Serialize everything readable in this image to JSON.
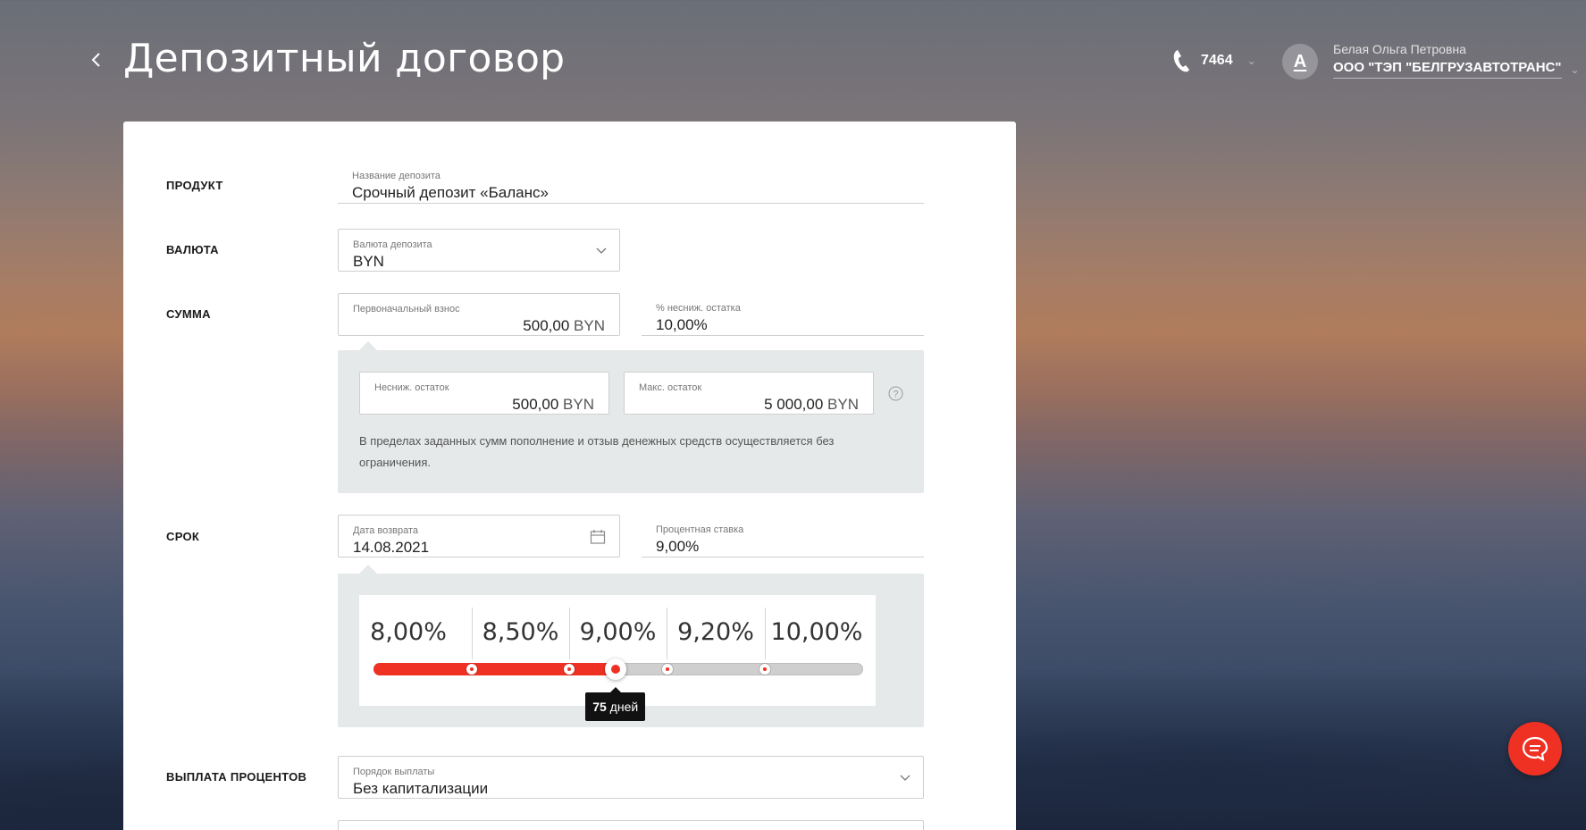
{
  "header": {
    "title": "Депозитный договор",
    "phone": "7464",
    "avatar_letter": "А",
    "user_name": "Белая Ольга Петровна",
    "organization": "ООО \"ТЭП \"БЕЛГРУЗАВТОТРАНС\""
  },
  "sections": {
    "product": "ПРОДУКТ",
    "currency": "ВАЛЮТА",
    "amount": "СУММА",
    "term": "СРОК",
    "interest_payment": "ВЫПЛАТА ПРОЦЕНТОВ"
  },
  "product": {
    "label": "Название депозита",
    "value": "Срочный депозит «Баланс»"
  },
  "currency": {
    "label": "Валюта депозита",
    "value": "BYN"
  },
  "amount": {
    "initial_label": "Первоначальный взнос",
    "initial_value": "500,00",
    "initial_currency": "BYN",
    "min_balance_pct_label": "% несниж. остатка",
    "min_balance_pct_value": "10,00%",
    "min_balance_label": "Несниж. остаток",
    "min_balance_value": "500,00",
    "min_balance_currency": "BYN",
    "max_balance_label": "Макс. остаток",
    "max_balance_value": "5 000,00",
    "max_balance_currency": "BYN",
    "note_line1": "В пределах заданных сумм пополнение и отзыв денежных средств осуществляется без",
    "note_line2": "ограничения."
  },
  "term": {
    "return_date_label": "Дата возврата",
    "return_date_value": "14.08.2021",
    "rate_label": "Процентная ставка",
    "rate_value": "9,00%",
    "rates": [
      "8,00%",
      "8,50%",
      "9,00%",
      "9,20%",
      "10,00%"
    ],
    "slider_fraction": 0.494,
    "tooltip_days": "75",
    "tooltip_unit": "дней"
  },
  "interest_payment": {
    "order_label": "Порядок выплаты",
    "order_value": "Без капитализации"
  },
  "colors": {
    "accent": "#ef3124",
    "panel": "#e6e9e9"
  }
}
